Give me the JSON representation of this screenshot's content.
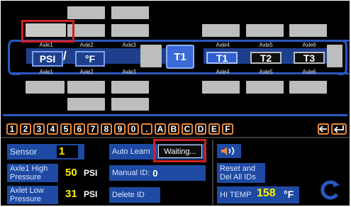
{
  "axles": {
    "left_top": [
      "Axle1",
      "Axle2",
      "Axle3"
    ],
    "left_bottom": [
      "Axle1",
      "Axle2",
      "Axle3"
    ],
    "right_top": [
      "Axle4",
      "Axle5",
      "Axle6"
    ],
    "right_bottom": [
      "Axle4",
      "Axle5",
      "Axle6"
    ]
  },
  "units": {
    "pressure": "PSI",
    "separator": "/",
    "temperature": "°F"
  },
  "trailer_buttons": {
    "main": "T1",
    "t1": "T1",
    "t2": "T2",
    "t3": "T3"
  },
  "keypad": [
    "1",
    "2",
    "3",
    "4",
    "5",
    "6",
    "7",
    "8",
    "9",
    "0",
    ".",
    "A",
    "B",
    "C",
    "D",
    "E",
    "F"
  ],
  "keypad_icons": [
    "backspace-arrow-icon",
    "enter-arrow-icon"
  ],
  "controls": {
    "sensor_label": "Sensor",
    "sensor_value": "1",
    "auto_learn_label": "Auto Learn",
    "auto_learn_status": "Waiting...",
    "high_pressure_label_1": "Axle1 High",
    "high_pressure_label_2": "Pressure",
    "high_pressure_value": "50",
    "high_pressure_unit": "PSI",
    "manual_id_label": "Manual ID:",
    "manual_id_value": "0",
    "reset_label_1": "Reset and",
    "reset_label_2": "Del All IDs",
    "low_pressure_label_1": "Axlet Low",
    "low_pressure_label_2": "Pressure",
    "low_pressure_value": "31",
    "low_pressure_unit": "PSI",
    "delete_id_label": "Delete ID",
    "hi_temp_label": "HI TEMP",
    "hi_temp_value": "158",
    "hi_temp_unit": "°F"
  },
  "colors": {
    "accent_blue": "#2b58c0",
    "value_yellow": "#ffee00",
    "keypad_orange": "#e9883a",
    "highlight_red": "#d22121"
  }
}
